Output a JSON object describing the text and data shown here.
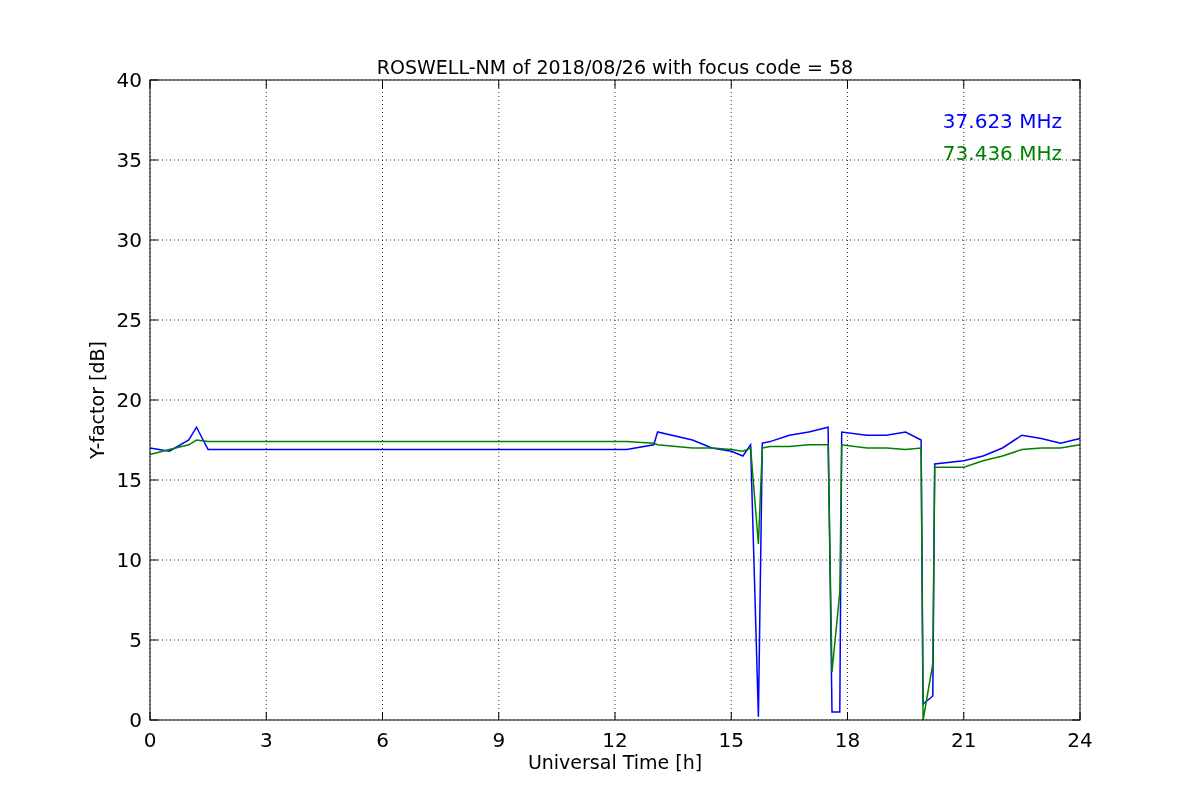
{
  "chart_data": {
    "type": "line",
    "title": "ROSWELL-NM of 2018/08/26 with focus code = 58",
    "xlabel": "Universal Time [h]",
    "ylabel": "Y-factor [dB]",
    "x": [
      0,
      0.5,
      1,
      1.2,
      1.5,
      12.3,
      13,
      13.1,
      14,
      14.5,
      15,
      15.3,
      15.5,
      15.7,
      15.8,
      16,
      16.5,
      17,
      17.5,
      17.6,
      17.8,
      17.85,
      18.5,
      19,
      19.5,
      19.9,
      19.95,
      20.2,
      20.25,
      21,
      21.5,
      22,
      22.5,
      23,
      23.5,
      24
    ],
    "series": [
      {
        "name": "37.623 MHz",
        "color": "#0000ff",
        "values": [
          17,
          16.8,
          17.5,
          18.3,
          16.9,
          16.9,
          17.2,
          18,
          17.5,
          17,
          16.8,
          16.5,
          17.2,
          0.2,
          17.3,
          17.4,
          17.8,
          18,
          18.3,
          0.5,
          0.5,
          18,
          17.8,
          17.8,
          18,
          17.5,
          1,
          1.5,
          16,
          16.2,
          16.5,
          17,
          17.8,
          17.6,
          17.3,
          17.6
        ]
      },
      {
        "name": "73.436 MHz",
        "color": "#008000",
        "values": [
          16.6,
          16.9,
          17.2,
          17.5,
          17.4,
          17.4,
          17.3,
          17.2,
          17,
          17,
          16.9,
          16.8,
          17,
          11,
          17,
          17.1,
          17.1,
          17.2,
          17.2,
          3,
          8,
          17.2,
          17,
          17,
          16.9,
          17,
          0,
          3.5,
          15.8,
          15.8,
          16.2,
          16.5,
          16.9,
          17,
          17,
          17.2
        ]
      }
    ],
    "xlim": [
      0,
      24
    ],
    "ylim": [
      0,
      40
    ],
    "xticks": [
      0,
      3,
      6,
      9,
      12,
      15,
      18,
      21,
      24
    ],
    "yticks": [
      0,
      5,
      10,
      15,
      20,
      25,
      30,
      35,
      40
    ],
    "grid": true
  }
}
